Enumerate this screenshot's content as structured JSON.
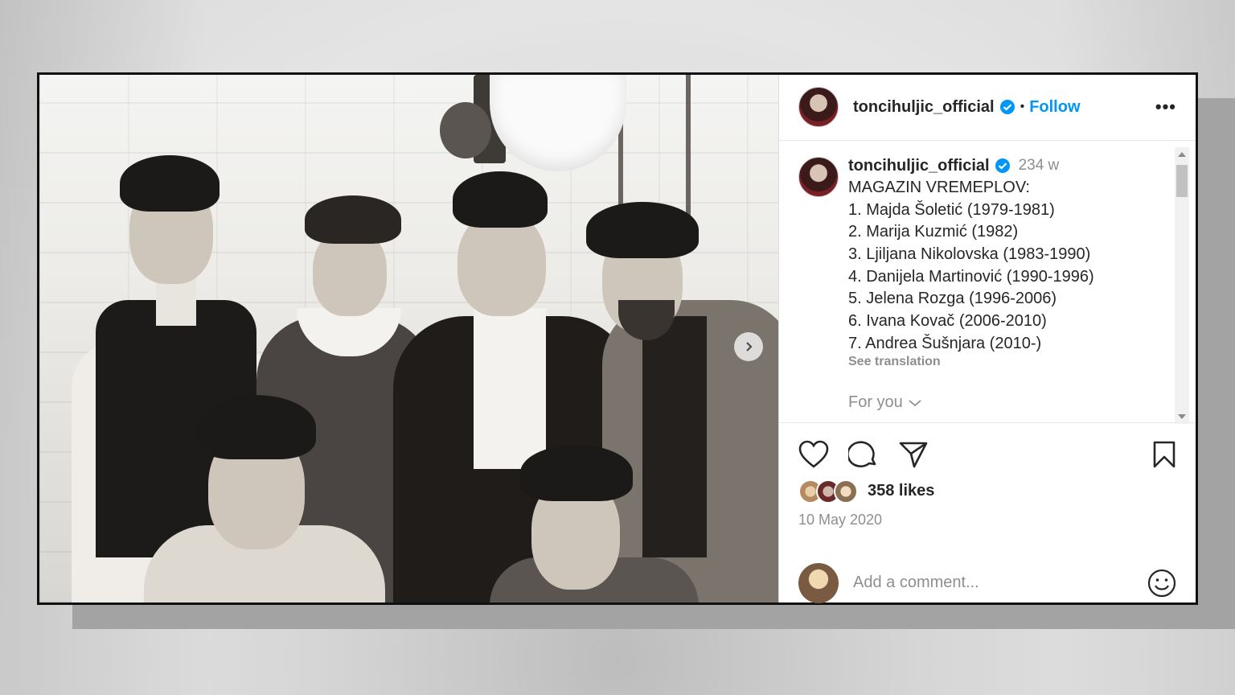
{
  "post": {
    "username": "toncihuljic_official",
    "follow_label": "Follow",
    "separator": "•",
    "more_label": "•••",
    "caption": {
      "username": "toncihuljic_official",
      "time": "234 w",
      "text": "MAGAZIN VREMEPLOV:\n1. Majda Šoletić (1979-1981)\n2. Marija Kuzmić (1982)\n3. Ljiljana Nikolovska (1983-1990)\n4. Danijela Martinović (1990-1996)\n5. Jelena Rozga (1996-2006)\n6. Ivana Kovač (2006-2010)\n7. Andrea Šušnjara (2010-)",
      "see_translation": "See translation"
    },
    "for_you_label": "For you",
    "likes": "358 likes",
    "date": "10 May 2020",
    "comment_placeholder": "Add a comment..."
  },
  "icons": {
    "verified": "verified-badge-icon",
    "like": "heart-icon",
    "comment": "comment-icon",
    "share": "send-icon",
    "save": "bookmark-icon",
    "emoji": "emoji-icon",
    "next": "chevron-right-icon"
  },
  "colors": {
    "accent": "#0095f6",
    "text": "#262626",
    "muted": "#8e8e8e"
  }
}
